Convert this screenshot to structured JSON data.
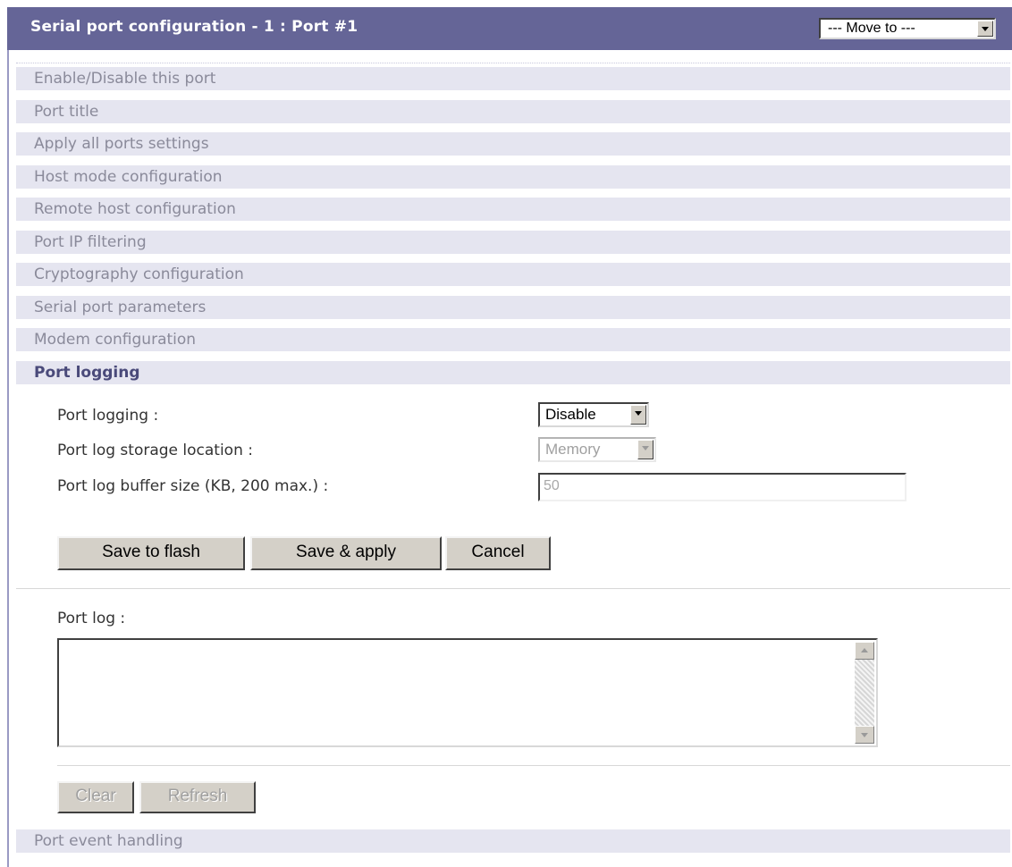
{
  "header": {
    "title": "Serial port configuration - 1 : Port #1",
    "move_to": "--- Move to ---"
  },
  "sections": [
    {
      "label": "Enable/Disable this port"
    },
    {
      "label": "Port title"
    },
    {
      "label": "Apply all ports settings"
    },
    {
      "label": "Host mode configuration"
    },
    {
      "label": "Remote host configuration"
    },
    {
      "label": "Port IP filtering"
    },
    {
      "label": "Cryptography configuration"
    },
    {
      "label": "Serial port parameters"
    },
    {
      "label": "Modem configuration"
    },
    {
      "label": "Port logging"
    }
  ],
  "port_logging": {
    "logging_label": "Port logging :",
    "logging_value": "Disable",
    "storage_label": "Port log storage location :",
    "storage_value": "Memory",
    "buffer_label": "Port log buffer size (KB, 200 max.) :",
    "buffer_value": "50"
  },
  "actions": {
    "save_flash": "Save to flash",
    "save_apply": "Save & apply",
    "cancel": "Cancel"
  },
  "port_log": {
    "label": "Port log :",
    "content": "",
    "clear": "Clear",
    "refresh": "Refresh"
  },
  "footer_section": {
    "label": "Port event handling"
  },
  "colors": {
    "header_bg": "#656597",
    "section_bg": "#e5e5f0",
    "active_section_text": "#4a4a7a"
  }
}
